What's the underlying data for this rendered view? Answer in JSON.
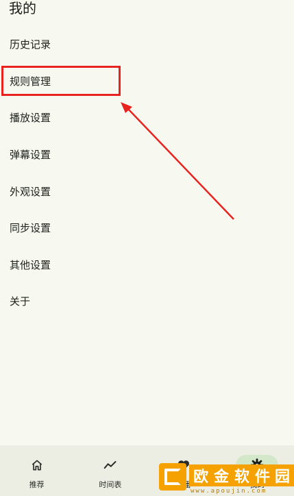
{
  "page": {
    "title": "我的"
  },
  "menu": {
    "items": [
      {
        "label": "历史记录"
      },
      {
        "label": "规则管理"
      },
      {
        "label": "播放设置"
      },
      {
        "label": "弹幕设置"
      },
      {
        "label": "外观设置"
      },
      {
        "label": "同步设置"
      },
      {
        "label": "其他设置"
      },
      {
        "label": "关于"
      }
    ]
  },
  "annotation": {
    "highlight_color": "#e8231f",
    "target": "规则管理"
  },
  "bottom_nav": {
    "items": [
      {
        "label": "推荐",
        "icon": "home-icon"
      },
      {
        "label": "时间表",
        "icon": "trending-icon"
      },
      {
        "label": "追番",
        "icon": "heart-icon"
      },
      {
        "label": "我的",
        "icon": "gear-icon",
        "active": true
      }
    ]
  },
  "watermark": {
    "chars": [
      "欧",
      "金",
      "软",
      "件",
      "园"
    ],
    "url": "www.apoujin.com"
  }
}
